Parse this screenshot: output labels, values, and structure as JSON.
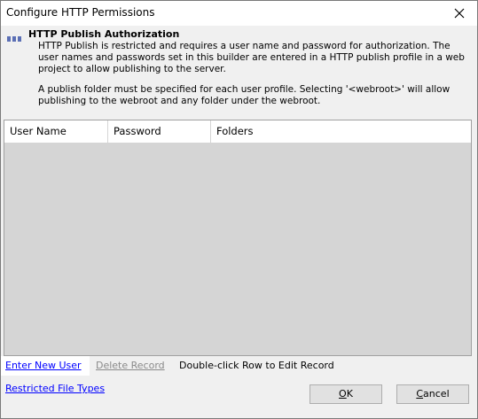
{
  "window": {
    "title": "Configure HTTP Permissions"
  },
  "header": {
    "title": "HTTP Publish Authorization",
    "paragraph1": "HTTP Publish is restricted and requires a user name and password for authorization.  The user names and passwords set in this builder are entered in a HTTP publish profile in a web project to allow publishing to the server.",
    "paragraph2": "A publish folder must be specified for each user profile.  Selecting '<webroot>' will allow publishing to the webroot and any folder under the webroot."
  },
  "grid": {
    "columns": [
      "User Name",
      "Password",
      "Folders"
    ],
    "rows": []
  },
  "actions": {
    "enter_new_user": "Enter New User",
    "delete_record": "Delete Record",
    "hint": "Double-click Row to Edit Record",
    "restricted_file_types": "Restricted File Types"
  },
  "buttons": {
    "ok_access": "O",
    "ok_rest": "K",
    "cancel_access": "C",
    "cancel_rest": "ancel"
  },
  "icons": {
    "close": "close-icon",
    "header": "server-icon"
  }
}
